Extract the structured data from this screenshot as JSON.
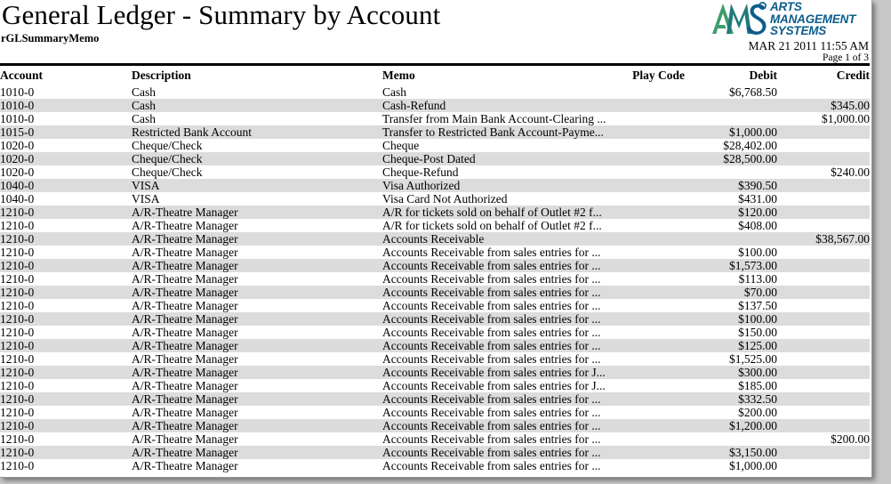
{
  "report": {
    "title": "General Ledger - Summary by Account",
    "subtitle": "rGLSummaryMemo",
    "timestamp": "MAR 21 2011 11:55 AM",
    "page_label": "Page 1 of 3"
  },
  "logo": {
    "mark_text": "AMS",
    "line1": "ARTS",
    "line2": "MANAGEMENT",
    "line3": "SYSTEMS",
    "color_green": "#3f9c6d",
    "color_teal": "#1f7a7a",
    "color_blue": "#0d5c8c",
    "text_color": "#0d5c8c"
  },
  "table": {
    "columns": [
      {
        "key": "account",
        "label": "Account",
        "align": "left"
      },
      {
        "key": "description",
        "label": "Description",
        "align": "left"
      },
      {
        "key": "memo",
        "label": "Memo",
        "align": "left"
      },
      {
        "key": "play_code",
        "label": "Play Code",
        "align": "right"
      },
      {
        "key": "debit",
        "label": "Debit",
        "align": "right"
      },
      {
        "key": "credit",
        "label": "Credit",
        "align": "right"
      }
    ],
    "row_shading": {
      "odd": "#ffffff",
      "even": "#dcdcdc"
    },
    "rows": [
      {
        "account": "1010-0",
        "description": "Cash",
        "memo": "Cash",
        "play_code": "",
        "debit": "$6,768.50",
        "credit": ""
      },
      {
        "account": "1010-0",
        "description": "Cash",
        "memo": "Cash-Refund",
        "play_code": "",
        "debit": "",
        "credit": "$345.00"
      },
      {
        "account": "1010-0",
        "description": "Cash",
        "memo": "Transfer from Main Bank Account-Clearing ...",
        "play_code": "",
        "debit": "",
        "credit": "$1,000.00"
      },
      {
        "account": "1015-0",
        "description": "Restricted Bank Account",
        "memo": "Transfer to Restricted Bank Account-Payme...",
        "play_code": "",
        "debit": "$1,000.00",
        "credit": ""
      },
      {
        "account": "1020-0",
        "description": "Cheque/Check",
        "memo": "Cheque",
        "play_code": "",
        "debit": "$28,402.00",
        "credit": ""
      },
      {
        "account": "1020-0",
        "description": "Cheque/Check",
        "memo": "Cheque-Post Dated",
        "play_code": "",
        "debit": "$28,500.00",
        "credit": ""
      },
      {
        "account": "1020-0",
        "description": "Cheque/Check",
        "memo": "Cheque-Refund",
        "play_code": "",
        "debit": "",
        "credit": "$240.00"
      },
      {
        "account": "1040-0",
        "description": "VISA",
        "memo": "Visa Authorized",
        "play_code": "",
        "debit": "$390.50",
        "credit": ""
      },
      {
        "account": "1040-0",
        "description": "VISA",
        "memo": "Visa Card Not Authorized",
        "play_code": "",
        "debit": "$431.00",
        "credit": ""
      },
      {
        "account": "1210-0",
        "description": "A/R-Theatre Manager",
        "memo": "A/R for tickets sold on behalf of Outlet #2 f...",
        "play_code": "",
        "debit": "$120.00",
        "credit": ""
      },
      {
        "account": "1210-0",
        "description": "A/R-Theatre Manager",
        "memo": "A/R for tickets sold on behalf of Outlet #2 f...",
        "play_code": "",
        "debit": "$408.00",
        "credit": ""
      },
      {
        "account": "1210-0",
        "description": "A/R-Theatre Manager",
        "memo": "Accounts Receivable",
        "play_code": "",
        "debit": "",
        "credit": "$38,567.00"
      },
      {
        "account": "1210-0",
        "description": "A/R-Theatre Manager",
        "memo": "Accounts Receivable from sales entries for ...",
        "play_code": "",
        "debit": "$100.00",
        "credit": ""
      },
      {
        "account": "1210-0",
        "description": "A/R-Theatre Manager",
        "memo": "Accounts Receivable from sales entries for ...",
        "play_code": "",
        "debit": "$1,573.00",
        "credit": ""
      },
      {
        "account": "1210-0",
        "description": "A/R-Theatre Manager",
        "memo": "Accounts Receivable from sales entries for ...",
        "play_code": "",
        "debit": "$113.00",
        "credit": ""
      },
      {
        "account": "1210-0",
        "description": "A/R-Theatre Manager",
        "memo": "Accounts Receivable from sales entries for ...",
        "play_code": "",
        "debit": "$70.00",
        "credit": ""
      },
      {
        "account": "1210-0",
        "description": "A/R-Theatre Manager",
        "memo": "Accounts Receivable from sales entries for ...",
        "play_code": "",
        "debit": "$137.50",
        "credit": ""
      },
      {
        "account": "1210-0",
        "description": "A/R-Theatre Manager",
        "memo": "Accounts Receivable from sales entries for ...",
        "play_code": "",
        "debit": "$100.00",
        "credit": ""
      },
      {
        "account": "1210-0",
        "description": "A/R-Theatre Manager",
        "memo": "Accounts Receivable from sales entries for ...",
        "play_code": "",
        "debit": "$150.00",
        "credit": ""
      },
      {
        "account": "1210-0",
        "description": "A/R-Theatre Manager",
        "memo": "Accounts Receivable from sales entries for ...",
        "play_code": "",
        "debit": "$125.00",
        "credit": ""
      },
      {
        "account": "1210-0",
        "description": "A/R-Theatre Manager",
        "memo": "Accounts Receivable from sales entries for ...",
        "play_code": "",
        "debit": "$1,525.00",
        "credit": ""
      },
      {
        "account": "1210-0",
        "description": "A/R-Theatre Manager",
        "memo": "Accounts Receivable from sales entries for J...",
        "play_code": "",
        "debit": "$300.00",
        "credit": ""
      },
      {
        "account": "1210-0",
        "description": "A/R-Theatre Manager",
        "memo": "Accounts Receivable from sales entries for J...",
        "play_code": "",
        "debit": "$185.00",
        "credit": ""
      },
      {
        "account": "1210-0",
        "description": "A/R-Theatre Manager",
        "memo": "Accounts Receivable from sales entries for ...",
        "play_code": "",
        "debit": "$332.50",
        "credit": ""
      },
      {
        "account": "1210-0",
        "description": "A/R-Theatre Manager",
        "memo": "Accounts Receivable from sales entries for ...",
        "play_code": "",
        "debit": "$200.00",
        "credit": ""
      },
      {
        "account": "1210-0",
        "description": "A/R-Theatre Manager",
        "memo": "Accounts Receivable from sales entries for ...",
        "play_code": "",
        "debit": "$1,200.00",
        "credit": ""
      },
      {
        "account": "1210-0",
        "description": "A/R-Theatre Manager",
        "memo": "Accounts Receivable from sales entries for ...",
        "play_code": "",
        "debit": "",
        "credit": "$200.00"
      },
      {
        "account": "1210-0",
        "description": "A/R-Theatre Manager",
        "memo": "Accounts Receivable from sales entries for ...",
        "play_code": "",
        "debit": "$3,150.00",
        "credit": ""
      },
      {
        "account": "1210-0",
        "description": "A/R-Theatre Manager",
        "memo": "Accounts Receivable from sales entries for ...",
        "play_code": "",
        "debit": "$1,000.00",
        "credit": ""
      }
    ]
  }
}
